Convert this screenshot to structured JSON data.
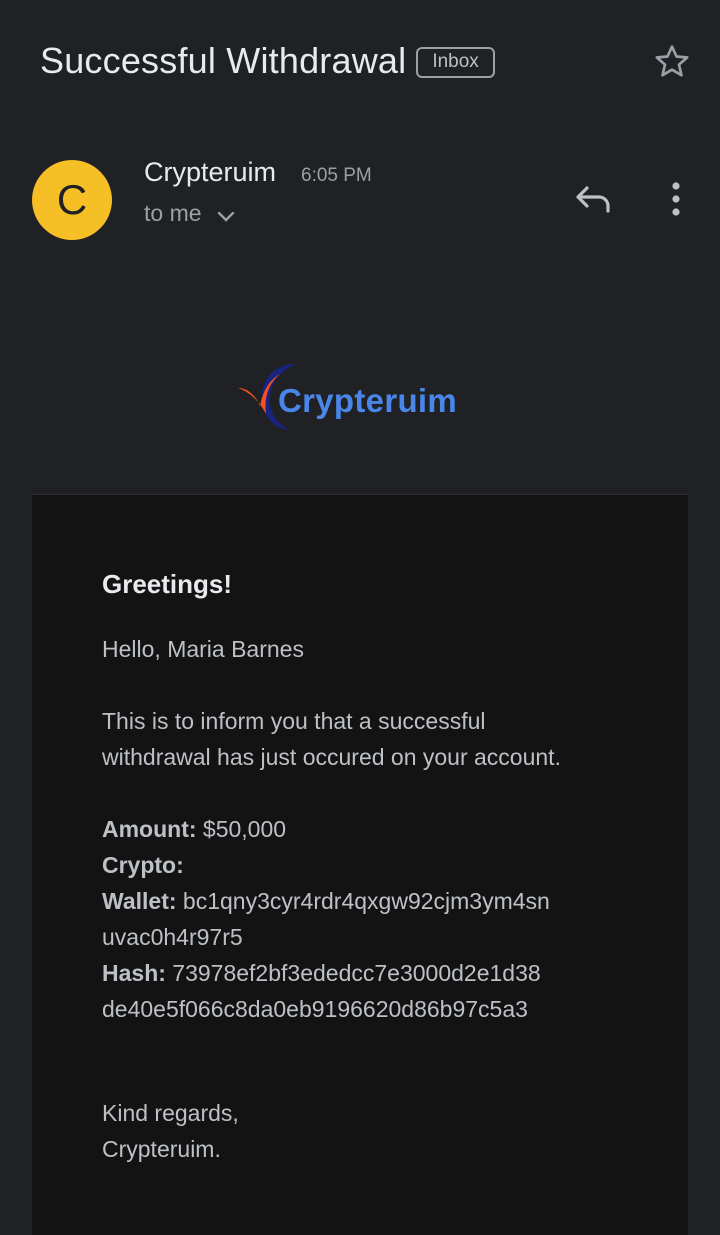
{
  "header": {
    "subject": "Successful Withdrawal",
    "label": "Inbox"
  },
  "sender": {
    "avatar_letter": "C",
    "name": "Crypteruim",
    "time": "6:05 PM",
    "recipient": "to me"
  },
  "icons": {
    "star": "star-outline-icon",
    "reply": "reply-icon",
    "more": "more-vert-icon",
    "chevron": "chevron-down-icon"
  },
  "logo": {
    "text": "Crypteruim"
  },
  "email": {
    "greeting": "Greetings!",
    "hello": "Hello, Maria Barnes",
    "inform_line1": "This is to inform you that a successful",
    "inform_line2": "withdrawal has just occured on your account.",
    "amount_label": "Amount:",
    "amount_value": " $50,000",
    "crypto_label": "Crypto:",
    "crypto_value": "",
    "wallet_label": "Wallet:",
    "wallet_value_line1": " bc1qny3cyr4rdr4qxgw92cjm3ym4sn",
    "wallet_value_line2": "uvac0h4r97r5",
    "hash_label": "Hash:",
    "hash_value_line1": " 73978ef2bf3ededcc7e3000d2e1d38",
    "hash_value_line2": "de40e5f066c8da0eb9196620d86b97c5a3",
    "regards_line1": "Kind regards,",
    "regards_line2": "Crypteruim."
  },
  "colors": {
    "background": "#202124",
    "card": "#131314",
    "avatar": "#f6bf26",
    "logo_blue": "#4a86e8",
    "logo_orange": "#f4511e"
  }
}
